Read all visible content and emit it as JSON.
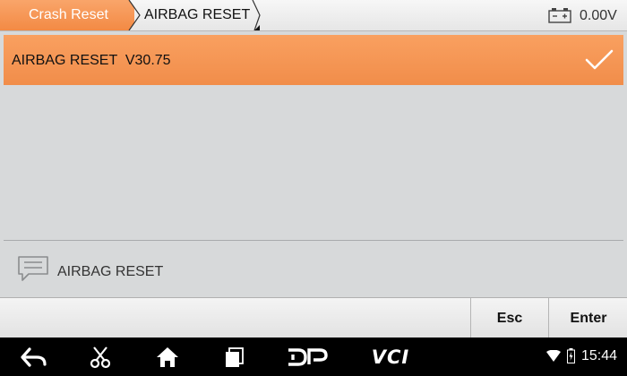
{
  "breadcrumb": {
    "home": "Crash Reset",
    "current": "AIRBAG RESET"
  },
  "status": {
    "voltage": "0.00V",
    "battery_icon": "car-battery-icon"
  },
  "list": {
    "items": [
      {
        "label": "AIRBAG RESET  V30.75",
        "selected": true,
        "icon": "checkmark-icon"
      }
    ]
  },
  "info": {
    "icon": "message-icon",
    "text": "AIRBAG RESET"
  },
  "actions": {
    "esc_label": "Esc",
    "enter_label": "Enter"
  },
  "navbar": {
    "icons": [
      "back-icon",
      "scissors-icon",
      "home-icon",
      "recent-apps-icon",
      "dp-icon",
      "vci-icon"
    ],
    "dp_text": "DP",
    "vci_text": "VCI",
    "time": "15:44"
  },
  "colors": {
    "accent": "#f38a44",
    "selected_row": "#f18d4a",
    "background": "#d7d9da"
  }
}
